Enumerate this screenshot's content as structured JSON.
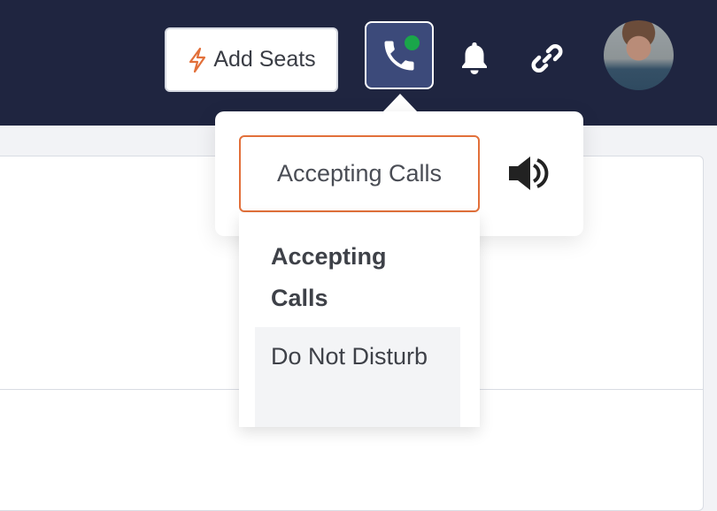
{
  "header": {
    "add_seats_label": "Add Seats",
    "call_status_color": "#1aa64a",
    "accent_color": "#e2703a"
  },
  "call_status": {
    "selected": "Accepting Calls",
    "options": [
      "Accepting Calls",
      "Do Not Disturb"
    ]
  },
  "icons": [
    "lightning-icon",
    "phone-icon",
    "bell-icon",
    "link-icon",
    "speaker-icon"
  ]
}
